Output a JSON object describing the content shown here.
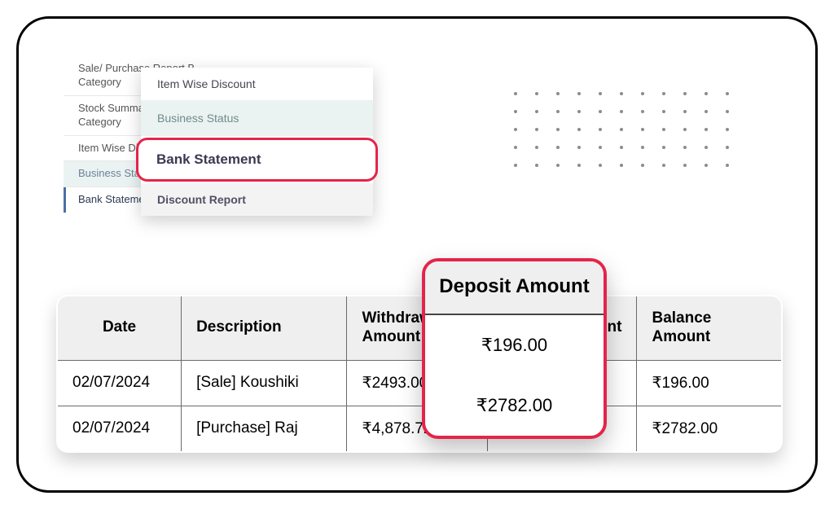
{
  "back_menu": {
    "items": [
      {
        "label": "Sale/ Purchase Report B Category"
      },
      {
        "label": "Stock Summary R Category"
      },
      {
        "label": "Item Wise Dis"
      },
      {
        "label": "Business Status"
      },
      {
        "label": "Bank Statement"
      }
    ]
  },
  "front_menu": {
    "items": [
      {
        "label": "Item Wise Discount"
      },
      {
        "label": "Business Status"
      },
      {
        "label": "Bank Statement"
      },
      {
        "label": "Discount Report"
      }
    ]
  },
  "table": {
    "headers": {
      "date": "Date",
      "description": "Description",
      "withdrawal": "Withdrawal Amount",
      "deposit": "Deposit Amount",
      "balance": "Balance Amount"
    },
    "rows": [
      {
        "date": "02/07/2024",
        "description": "[Sale] Koushiki",
        "withdrawal": "₹2493.00",
        "deposit": "₹196.00",
        "balance": "₹196.00"
      },
      {
        "date": "02/07/2024",
        "description": "[Purchase] Raj",
        "withdrawal": "₹4,878.72",
        "deposit": "₹2782.00",
        "balance": "₹2782.00"
      }
    ]
  },
  "deposit_highlight": {
    "title": "Deposit Amount",
    "values": [
      "₹196.00",
      "₹2782.00"
    ]
  }
}
